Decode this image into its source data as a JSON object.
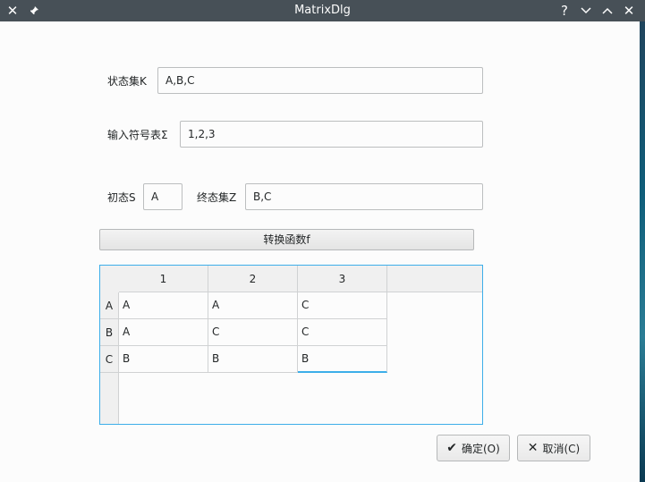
{
  "window": {
    "title": "MatrixDlg"
  },
  "titlebar": {
    "icons": [
      "close-icon",
      "pin-icon",
      "help-icon",
      "minimize-icon",
      "maximize-icon",
      "close-icon"
    ]
  },
  "form": {
    "state_set_label": "状态集K",
    "state_set_value": "A,B,C",
    "alphabet_label": "输入符号表Σ",
    "alphabet_value": "1,2,3",
    "initial_label": "初态S",
    "initial_value": "A",
    "final_label": "终态集Z",
    "final_value": "B,C",
    "transform_button": "转换函数f"
  },
  "table": {
    "columns": [
      "1",
      "2",
      "3"
    ],
    "rows": [
      {
        "header": "A",
        "cells": [
          "A",
          "A",
          "C"
        ]
      },
      {
        "header": "B",
        "cells": [
          "A",
          "C",
          "C"
        ]
      },
      {
        "header": "C",
        "cells": [
          "B",
          "B",
          "B"
        ]
      }
    ]
  },
  "buttons": {
    "ok": "确定(O)",
    "cancel": "取消(C)"
  },
  "colors": {
    "titlebar": "#475057",
    "accent": "#3daee9",
    "background": "#fcfcfc"
  }
}
